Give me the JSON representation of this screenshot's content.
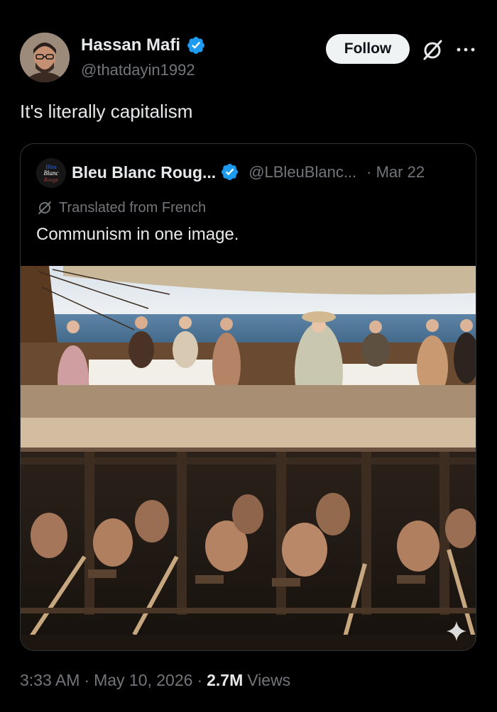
{
  "author": {
    "display_name": "Hassan Mafi",
    "handle": "@thatdayin1992"
  },
  "actions": {
    "follow_label": "Follow",
    "grok_icon": "grok-icon",
    "more_icon": "more-icon"
  },
  "tweet": {
    "text": "It's literally capitalism"
  },
  "quote": {
    "avatar_text": "Bleu Blanc Rouge",
    "display_name": "Bleu Blanc Roug...",
    "handle": "@LBleuBlanc...",
    "date": "· Mar 22",
    "translated_label": "Translated from French",
    "text": "Communism in one image."
  },
  "meta": {
    "time": "3:33 AM",
    "separator": "·",
    "date": "May 10, 2026",
    "views_count": "2.7M",
    "views_label": "Views"
  },
  "colors": {
    "background": "#000000",
    "text": "#e7e9ea",
    "secondary": "#71767b",
    "verified": "#1d9bf0",
    "border": "#2f3336"
  }
}
